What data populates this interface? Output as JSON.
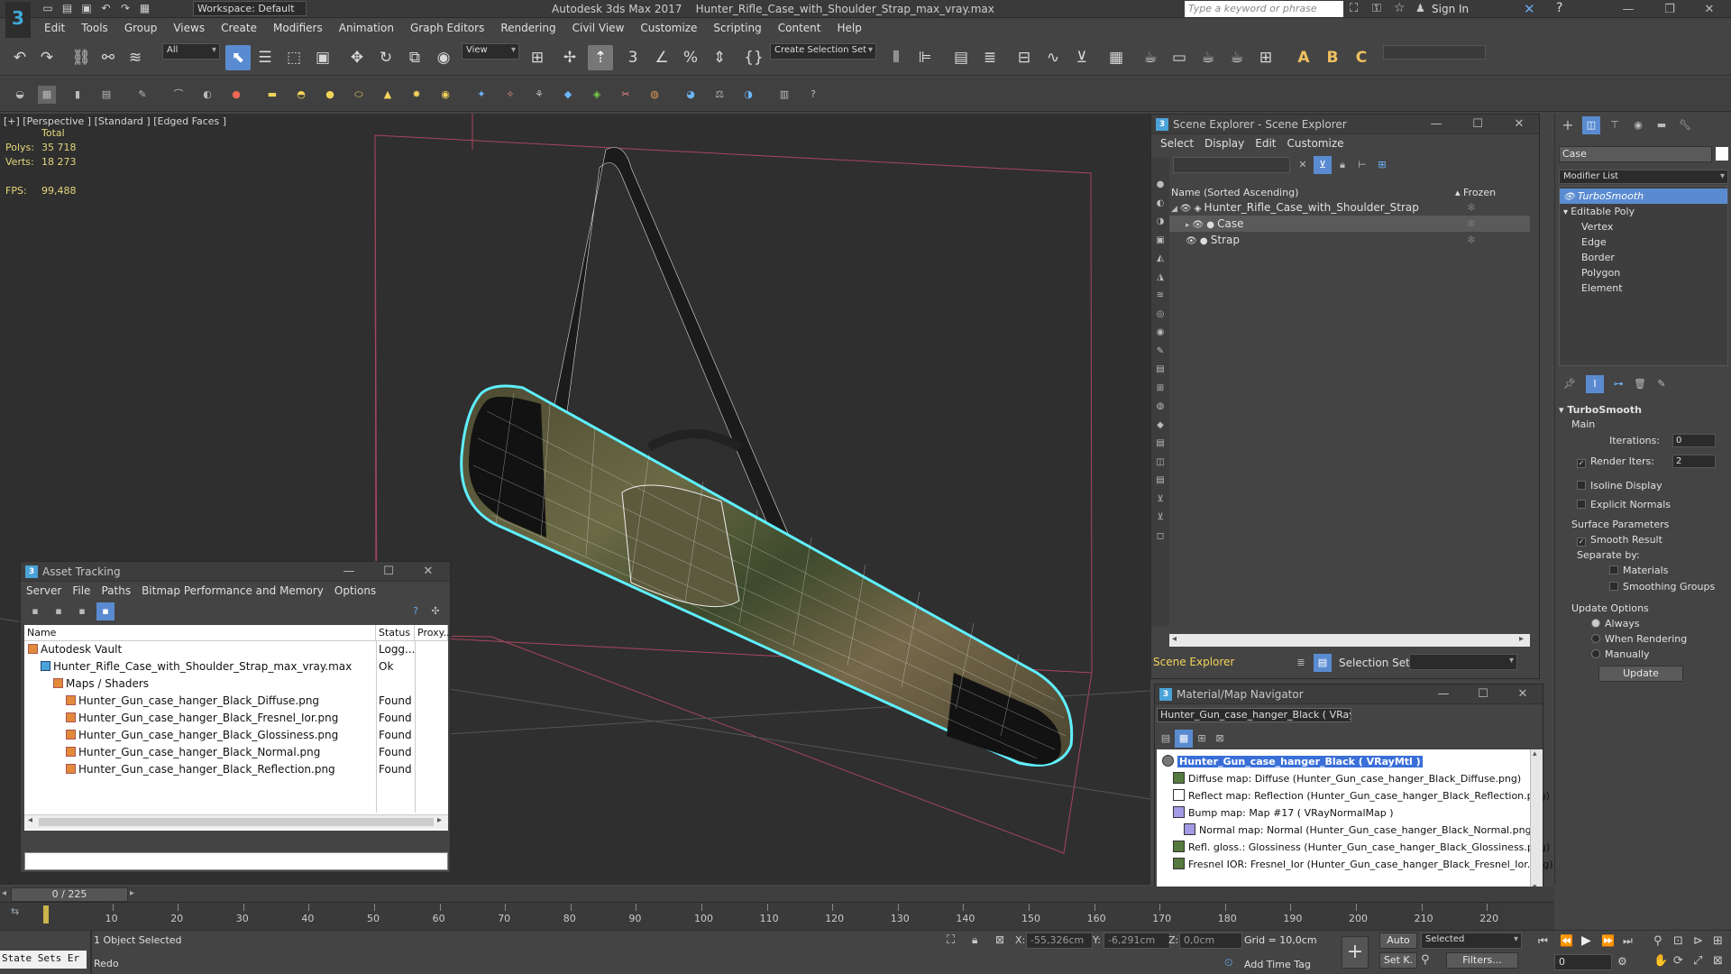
{
  "app": {
    "title": "Autodesk 3ds Max 2017    Hunter_Rifle_Case_with_Shoulder_Strap_max_vray.max",
    "workspace": "Workspace: Default",
    "search_placeholder": "Type a keyword or phrase",
    "sign_in": "Sign In"
  },
  "menu": [
    "Edit",
    "Tools",
    "Group",
    "Views",
    "Create",
    "Modifiers",
    "Animation",
    "Graph Editors",
    "Rendering",
    "Civil View",
    "Customize",
    "Scripting",
    "Content",
    "Help"
  ],
  "toolbar": {
    "filter": "All",
    "ref_coord": "View",
    "selection_set": "Create Selection Set"
  },
  "viewport": {
    "label": "[+] [Perspective ] [Standard ] [Edged Faces ]",
    "stats_header": "Total",
    "polys_label": "Polys:",
    "polys": "35 718",
    "verts_label": "Verts:",
    "verts": "18 273",
    "fps_label": "FPS:",
    "fps": "99,488"
  },
  "asset_tracking": {
    "title": "Asset Tracking",
    "menu": [
      "Server",
      "File",
      "Paths",
      "Bitmap Performance and Memory",
      "Options"
    ],
    "columns": [
      "Name",
      "Status",
      "Proxy..."
    ],
    "rows": [
      {
        "name": "Autodesk Vault",
        "status": "Logg...",
        "indent": 0
      },
      {
        "name": "Hunter_Rifle_Case_with_Shoulder_Strap_max_vray.max",
        "status": "Ok",
        "indent": 1
      },
      {
        "name": "Maps / Shaders",
        "status": "",
        "indent": 2
      },
      {
        "name": "Hunter_Gun_case_hanger_Black_Diffuse.png",
        "status": "Found",
        "indent": 3
      },
      {
        "name": "Hunter_Gun_case_hanger_Black_Fresnel_Ior.png",
        "status": "Found",
        "indent": 3
      },
      {
        "name": "Hunter_Gun_case_hanger_Black_Glossiness.png",
        "status": "Found",
        "indent": 3
      },
      {
        "name": "Hunter_Gun_case_hanger_Black_Normal.png",
        "status": "Found",
        "indent": 3
      },
      {
        "name": "Hunter_Gun_case_hanger_Black_Reflection.png",
        "status": "Found",
        "indent": 3
      }
    ]
  },
  "scene_explorer": {
    "title": "Scene Explorer - Scene Explorer",
    "menu": [
      "Select",
      "Display",
      "Edit",
      "Customize"
    ],
    "col_name": "Name (Sorted Ascending)",
    "col_frozen": "▴ Frozen",
    "rows": [
      {
        "name": "Hunter_Rifle_Case_with_Shoulder_Strap",
        "indent": 0,
        "selected": false
      },
      {
        "name": "Case",
        "indent": 1,
        "selected": true
      },
      {
        "name": "Strap",
        "indent": 1,
        "selected": false
      }
    ],
    "footer_label": "Scene Explorer",
    "selection_set_label": "Selection Set:"
  },
  "material_navigator": {
    "title": "Material/Map Navigator",
    "current": "Hunter_Gun_case_hanger_Black  ( VRayMtl )",
    "rows": [
      {
        "text": "Hunter_Gun_case_hanger_Black  ( VRayMtl )",
        "indent": 0,
        "highlight": true
      },
      {
        "text": "Diffuse map: Diffuse (Hunter_Gun_case_hanger_Black_Diffuse.png)",
        "indent": 1,
        "highlight": false
      },
      {
        "text": "Reflect map: Reflection (Hunter_Gun_case_hanger_Black_Reflection.png)",
        "indent": 1,
        "highlight": false
      },
      {
        "text": "Bump map: Map #17  ( VRayNormalMap )",
        "indent": 1,
        "highlight": false
      },
      {
        "text": "Normal map: Normal (Hunter_Gun_case_hanger_Black_Normal.png)",
        "indent": 2,
        "highlight": false
      },
      {
        "text": "Refl. gloss.: Glossiness (Hunter_Gun_case_hanger_Black_Glossiness.png)",
        "indent": 1,
        "highlight": false
      },
      {
        "text": "Fresnel IOR: Fresnel_Ior (Hunter_Gun_case_hanger_Black_Fresnel_Ior.png)",
        "indent": 1,
        "highlight": false
      }
    ]
  },
  "command_panel": {
    "object_name": "Case",
    "modifier_list": "Modifier List",
    "stack": [
      {
        "label": "TurboSmooth",
        "level": 0,
        "selected": true
      },
      {
        "label": "Editable Poly",
        "level": 0,
        "selected": false
      },
      {
        "label": "Vertex",
        "level": 1,
        "selected": false
      },
      {
        "label": "Edge",
        "level": 1,
        "selected": false
      },
      {
        "label": "Border",
        "level": 1,
        "selected": false
      },
      {
        "label": "Polygon",
        "level": 1,
        "selected": false
      },
      {
        "label": "Element",
        "level": 1,
        "selected": false
      }
    ],
    "turbosmooth": {
      "title": "TurboSmooth",
      "main": "Main",
      "iterations_label": "Iterations:",
      "iterations": "0",
      "render_iters_label": "Render Iters:",
      "render_iters": "2",
      "isoline": "Isoline Display",
      "explicit_normals": "Explicit Normals",
      "surface_params": "Surface Parameters",
      "smooth_result": "Smooth Result",
      "separate_by": "Separate by:",
      "materials": "Materials",
      "smoothing_groups": "Smoothing Groups",
      "update_options": "Update Options",
      "always": "Always",
      "when_rendering": "When Rendering",
      "manually": "Manually",
      "update": "Update"
    }
  },
  "timeline": {
    "frame": "0 / 225",
    "ticks": [
      "10",
      "20",
      "30",
      "40",
      "50",
      "60",
      "70",
      "80",
      "90",
      "100",
      "110",
      "120",
      "130",
      "140",
      "150",
      "160",
      "170",
      "180",
      "190",
      "200",
      "210",
      "220"
    ]
  },
  "status": {
    "state_sets": "State Sets Er",
    "selected": "1 Object Selected",
    "redo": "Redo",
    "x_label": "X:",
    "x": "-55,326cm",
    "y_label": "Y:",
    "y": "-6,291cm",
    "z_label": "Z:",
    "z": "0,0cm",
    "grid": "Grid = 10,0cm",
    "add_time_tag": "Add Time Tag",
    "auto": "Auto",
    "set_k": "Set K.",
    "selected_dd": "Selected",
    "filters": "Filters...",
    "frame_field": "0"
  }
}
